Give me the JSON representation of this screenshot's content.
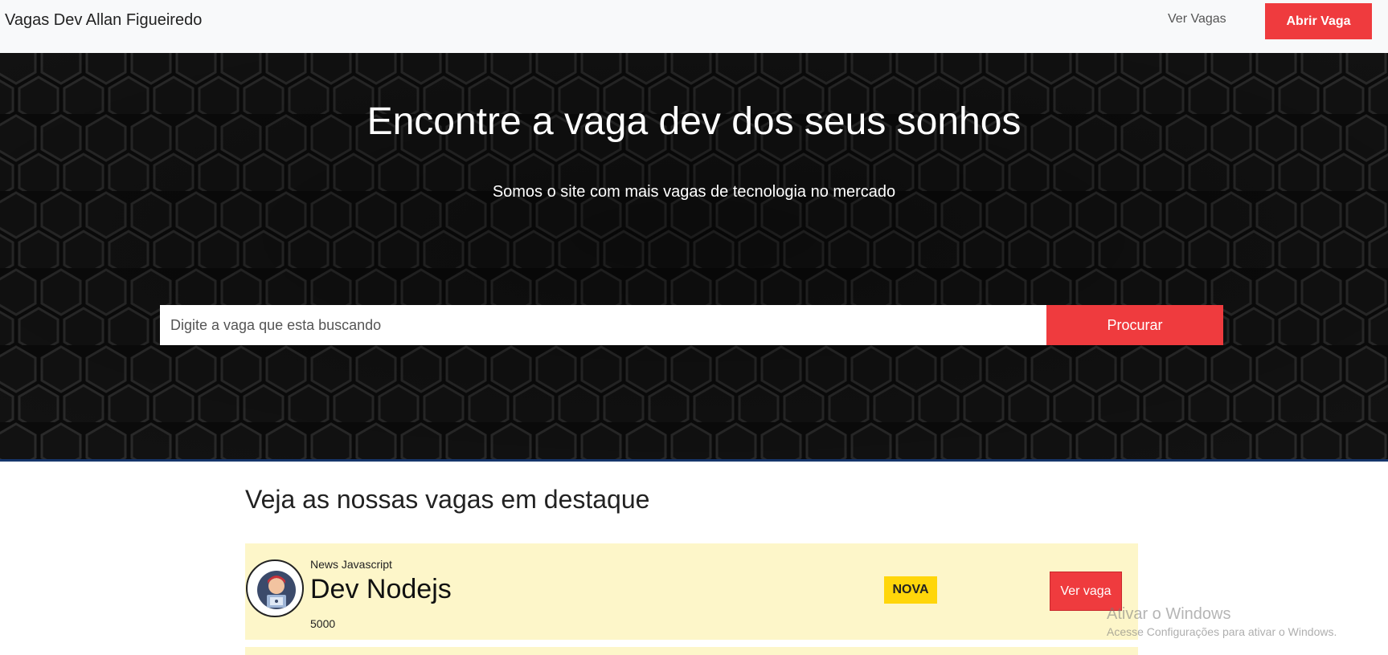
{
  "navbar": {
    "brand": "Vagas Dev Allan Figueiredo",
    "link_label": "Ver Vagas",
    "cta_label": "Abrir Vaga"
  },
  "hero": {
    "title": "Encontre a vaga dev dos seus sonhos",
    "subtitle": "Somos o site com mais vagas de tecnologia no mercado",
    "search_placeholder": "Digite a vaga que esta buscando",
    "search_value": "",
    "search_button": "Procurar"
  },
  "featured": {
    "title": "Veja as nossas vagas em destaque",
    "jobs": [
      {
        "company": "News Javascript",
        "title": "Dev Nodejs",
        "salary": "5000",
        "badge": "NOVA",
        "button_label": "Ver vaga"
      }
    ]
  },
  "watermark": {
    "title": "Ativar o Windows",
    "subtitle": "Acesse Configurações para ativar o Windows."
  },
  "colors": {
    "accent_red": "#ef3b3e",
    "badge_yellow": "#ffd60a",
    "card_bg": "#fdf6c9",
    "hero_bg": "#0b0b0b",
    "hero_border": "#16356b"
  }
}
